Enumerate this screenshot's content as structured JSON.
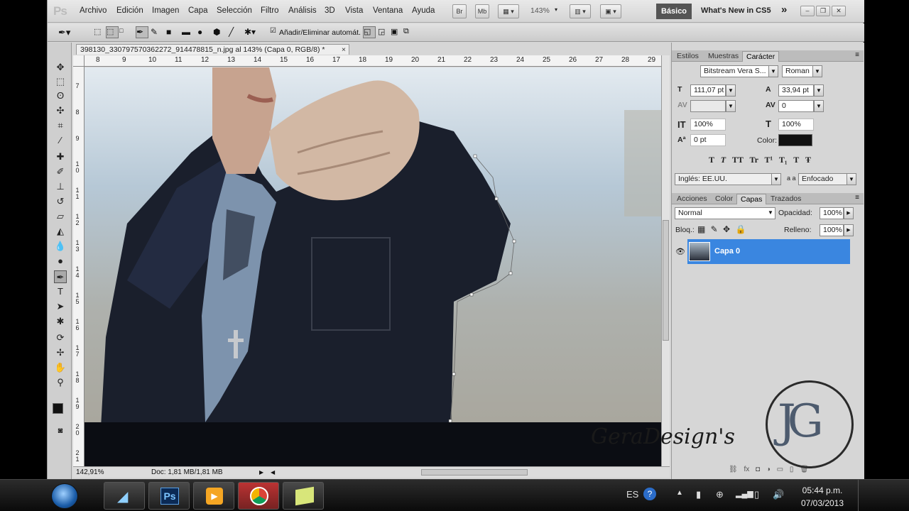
{
  "app": {
    "logo": "Ps"
  },
  "menu": [
    "Archivo",
    "Edición",
    "Imagen",
    "Capa",
    "Selección",
    "Filtro",
    "Análisis",
    "3D",
    "Vista",
    "Ventana",
    "Ayuda"
  ],
  "menubar": {
    "br_label": "Br",
    "mb_label": "Mb",
    "zoom": "143%",
    "workspace_active": "Básico",
    "whats_new": "What's New in CS5",
    "more": "»"
  },
  "options": {
    "auto_add_label": "Añadir/Eliminar automát."
  },
  "document": {
    "tab_title": "398130_330797570362272_914478815_n.jpg al 143% (Capa 0, RGB/8) *",
    "close_symbol": "×",
    "ruler_h": [
      "8",
      "9",
      "10",
      "11",
      "12",
      "13",
      "14",
      "15",
      "16",
      "17",
      "18",
      "19",
      "20",
      "21",
      "22",
      "23",
      "24",
      "25",
      "26",
      "27",
      "28",
      "29"
    ],
    "ruler_v": [
      "7",
      "8",
      "9",
      "1 0",
      "1 1",
      "1 2",
      "1 3",
      "1 4",
      "1 5",
      "1 6",
      "1 7",
      "1 8",
      "1 9",
      "2 0",
      "2 1"
    ]
  },
  "status": {
    "zoom": "142,91%",
    "doc": "Doc: 1,81 MB/1,81 MB"
  },
  "character_panel": {
    "tabs": [
      "Estilos",
      "Muestras",
      "Carácter"
    ],
    "active_tab": "Carácter",
    "font_family": "Bitstream Vera S...",
    "font_style": "Roman",
    "size": "111,07 pt",
    "leading": "33,94 pt",
    "kerning": "",
    "tracking": "0",
    "vscale": "100%",
    "hscale": "100%",
    "baseline": "0 pt",
    "color_label": "Color:",
    "color_value": "#111111",
    "language": "Inglés: EE.UU.",
    "aa_label": "a a",
    "antialias": "Enfocado"
  },
  "layers_panel": {
    "tabs": [
      "Acciones",
      "Color",
      "Capas",
      "Trazados"
    ],
    "active_tab": "Capas",
    "blend_mode": "Normal",
    "opacity_label": "Opacidad:",
    "opacity": "100%",
    "lock_label": "Bloq.:",
    "fill_label": "Relleno:",
    "fill": "100%",
    "layers": [
      {
        "name": "Capa 0"
      }
    ]
  },
  "watermark": {
    "text": "GeraDesign's",
    "monogram": "JG"
  },
  "taskbar": {
    "lang": "ES",
    "time": "05:44 p.m.",
    "date": "07/03/2013",
    "ps_label": "Ps"
  }
}
